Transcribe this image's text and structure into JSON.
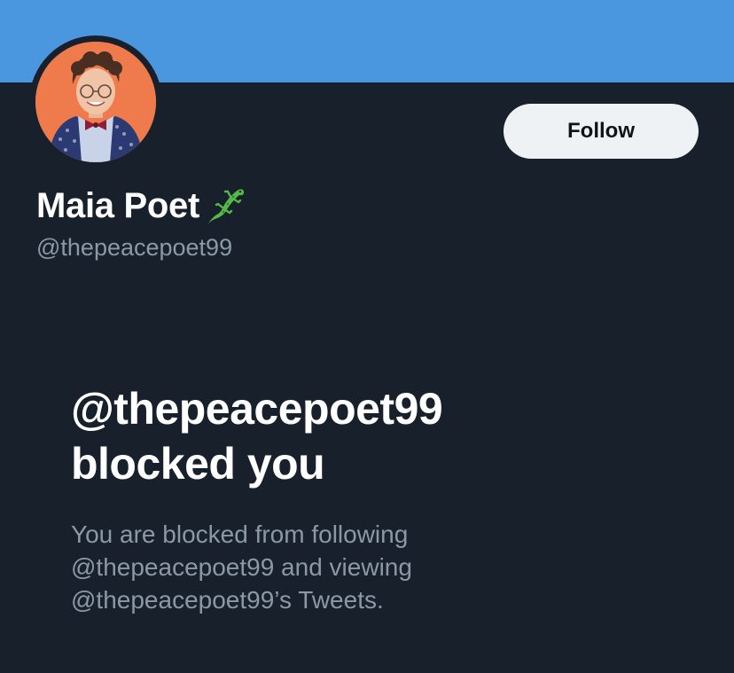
{
  "colors": {
    "banner": "#4a97df",
    "background": "#17202b",
    "avatar_bg": "#ef7a4b",
    "follow_button_bg": "#eef2f4",
    "secondary_text": "#8b98a5"
  },
  "profile": {
    "display_name": "Maia Poet",
    "name_emoji_icon": "lizard-icon",
    "handle": "@thepeacepoet99",
    "avatar_icon": "profile-photo"
  },
  "actions": {
    "follow_label": "Follow"
  },
  "blocked_notice": {
    "title_line1": "@thepeacepoet99",
    "title_line2": "blocked you",
    "description_line1": "You are blocked from following",
    "description_line2": "@thepeacepoet99 and viewing",
    "description_line3": "@thepeacepoet99’s Tweets."
  }
}
